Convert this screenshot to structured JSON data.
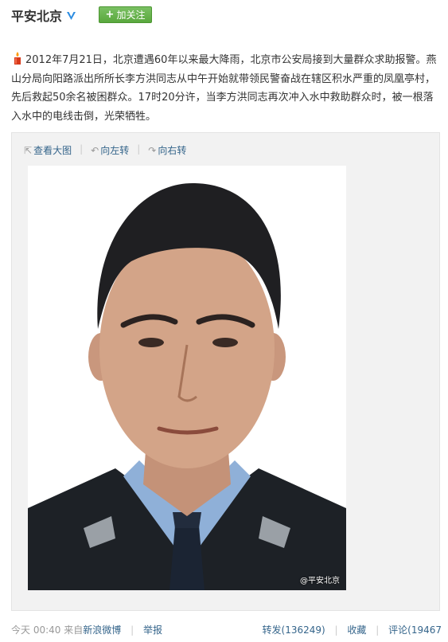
{
  "header": {
    "author": "平安北京",
    "follow_label": "加关注"
  },
  "post": {
    "text": "2012年7月21日，北京遭遇60年以来最大降雨，北京市公安局接到大量群众求助报警。燕山分局向阳路派出所所长李方洪同志从中午开始就带领民警奋战在辖区积水严重的凤凰亭村，先后救起50余名被困群众。17时20分许，当李方洪同志再次冲入水中救助群众时，被一根落入水中的电线击倒，光荣牺牲。"
  },
  "media": {
    "view_large": "查看大图",
    "rotate_left": "向左转",
    "rotate_right": "向右转",
    "watermark": "@平安北京"
  },
  "footer": {
    "time": "今天 00:40",
    "from_prefix": "来自",
    "source": "新浪微博",
    "report": "举报",
    "repost": "转发(136249)",
    "favorite": "收藏",
    "comment": "评论(19467"
  },
  "colors": {
    "link": "#35658b",
    "follow_green": "#5aa83d",
    "verified_blue": "#2d8de1"
  }
}
